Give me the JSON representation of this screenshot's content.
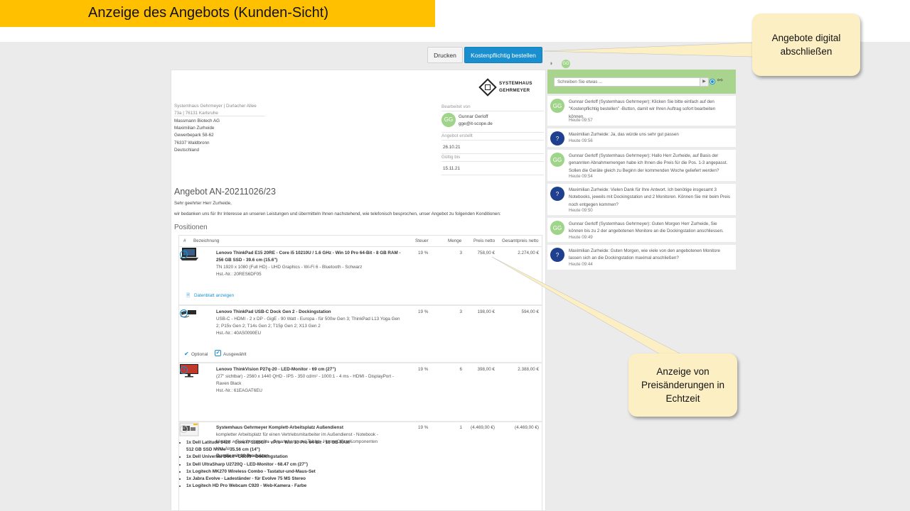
{
  "slide_title": "Anzeige des Angebots (Kunden-Sicht)",
  "toolbar": {
    "print_label": "Drucken",
    "order_label": "Kostenpflichtig bestellen"
  },
  "logo": {
    "line1": "SYSTEMHAUS",
    "line2": "GEHRMEYER"
  },
  "document": {
    "sender": "Systemhaus Gehrmeyer | Durlacher Allee",
    "sender2": "73a | 76131 Karlsruhe",
    "address": [
      "Massmann Biotech AG",
      "Maximilian Zurheide",
      "Gewerbepark 58-62",
      "76337 Waldbronn",
      "Deutschland"
    ],
    "meta": {
      "edited_label": "Bearbeitet von",
      "person_initials": "GG",
      "person_name": "Gunnar Gerloff",
      "person_email": "gge@it-scope.de",
      "created_label": "Angebot erstellt",
      "created_value": "26.10.21",
      "valid_label": "Gültig bis",
      "valid_value": "15.11.21"
    },
    "offer_title": "Angebot AN-20211026/23",
    "greeting": "Sehr geehrter Herr Zurheide,",
    "intro": "wir bedanken uns für Ihr Interesse an unseren Leistungen und übermitteln Ihnen nachstehend, wie telefonisch besprochen, unser Angebot zu folgenden Konditionen:",
    "positions_heading": "Positionen",
    "columns": {
      "num": "#",
      "name": "Bezeichnung",
      "tax": "Steuer",
      "qty": "Menge",
      "price": "Preis netto",
      "total": "Gesamtpreis netto"
    },
    "positions": [
      {
        "num": "1",
        "name": "Lenovo ThinkPad E15 20RE - Core i5 10210U / 1.6 GHz - Win 10 Pro 64-Bit - 8 GB RAM -",
        "name2": "256 GB SSD - 39.6 cm (15.6\")",
        "desc": "TN 1920 x 1080 (Full HD) - UHD Graphics - Wi-Fi 6 - Bluetooth - Schwarz",
        "desc2": "Hst.-Nr.: 20RES6DF05",
        "link": "Datenblatt anzeigen",
        "tax": "19 %",
        "qty": "3",
        "price": "758,00 €",
        "total": "2.274,00 €"
      },
      {
        "num": "2",
        "name": "Lenovo ThinkPad USB-C Dock Gen 2 - Dockingstation",
        "desc": "USB-C - HDMI - 2 x DP - GigE - 90 Watt - Europa - für 500w Gen 3; ThinkPad L13 Yoga Gen",
        "desc2": "2; P15v Gen 2; T14s Gen 2; T15p Gen 2; X13 Gen 2",
        "desc3": "Hst.-Nr.: 40AS0090EU",
        "optional": "Optional",
        "selected": "Ausgewählt",
        "tax": "19 %",
        "qty": "3",
        "price": "198,00 €",
        "total": "594,00 €"
      },
      {
        "num": "3",
        "name": "Lenovo ThinkVision P27q-20 - LED-Monitor - 69 cm (27\")",
        "desc": "(27\" sichtbar) - 2560 x 1440 QHD - IPS - 350 cd/m² - 1000:1 - 4 ms - HDMI - DisplayPort -",
        "desc2": "Raven Black",
        "desc3": "Hst.-Nr.: 61EAGAT6EU",
        "tax": "19 %",
        "qty": "6",
        "price": "398,00 €",
        "total": "2.388,00 €"
      },
      {
        "num": "4",
        "name": "Systemhaus Gehrmeyer Komplett-Arbeitsplatz Außendienst",
        "desc": "kompletter Arbeitsplatz für einen Vertriebsmitarbeiter im Außendienst - Notebook -",
        "desc2": "Monitor + Peripheriegeräte - Smartphone und Tablet - Home-Office Komponenten",
        "desc3": "Hst.-Nr.:",
        "bundle_title": "Bundle mit 10 Produkten",
        "bundle": [
          "1x Dell Latitude 5420 - Core i7 1185G7 - vPro - Win 10 Pro 64-Bit - 16 GB RAM -",
          "512 GB SSD NVMe - 35.56 cm (14\")",
          "1x Dell Universal Dock - D6000 - Dockingstation",
          "1x Dell UltraSharp U2720Q - LED-Monitor - 68.47 cm (27\")",
          "1x Logitech MK270 Wireless Combo - Tastatur-und-Maus-Set",
          "1x Jabra Evolve - Ladeständer - für Evolve 75 MS Stereo",
          "1x Logitech HD Pro Webcam C920 - Web-Kamera - Farbe"
        ],
        "tax": "19 %",
        "qty": "1",
        "price": "(4.469,00 €)",
        "total": "(4.469,00 €)"
      }
    ]
  },
  "chat": {
    "placeholder": "Schreiben Sie etwas ...",
    "messages": [
      {
        "initials": "GG",
        "text": "Gunnar Gerloff (Systemhaus Gehrmeyer): Klicken Sie bitte einfach auf den \"Kostenpflichtig bestellen\" -Button, damit wir Ihren Auftrag sofort bearbeiten können.",
        "time": "Heute 09:57"
      },
      {
        "initials": "?",
        "text": "Maximilian Zurheide: Ja, das würde uns sehr gut passen",
        "time": "Heute 09:56"
      },
      {
        "initials": "GG",
        "text": "Gunnar Gerloff (Systemhaus Gehrmeyer): Hallo Herr Zurheide, auf Basis der genannten Abnahmemengen habe ich Ihnen die Preis für die Pos. 1-3 angepasst. Sollen die Geräte gleich zu Beginn der kommenden Woche geliefert werden?",
        "time": "Heute 09:54"
      },
      {
        "initials": "?",
        "text": "Maximilian Zurheide: Vielen Dank für Ihre Antwort. Ich benötige insgesamt 3 Notebooks, jeweils mit Dockingstation und 2 Monitoren. Können Sie mir beim Preis noch entgegen kommen?",
        "time": "Heute 09:50"
      },
      {
        "initials": "GG",
        "text": "Gunnar Gerloff (Systemhaus Gehrmeyer): Guten Morgen Herr Zurheide, Sie können bis zu 2 der angebotenen Monitore an die Dockingstation anschliessen.",
        "time": "Heute 09:49"
      },
      {
        "initials": "?",
        "text": "Maximilian Zurheide: Guten Morgen, wie viele von den angebotenen Monitore lassen sich an die Dockingstation maximal anschließen?",
        "time": "Heute 09:44"
      }
    ]
  },
  "callouts": {
    "top": "Angebote digital abschließen",
    "bottom": "Anzeige von Preisänderungen in Echtzeit"
  },
  "colors": {
    "banner": "#ffc000",
    "accent": "#1a8fd0",
    "chat_header": "#a8d48e",
    "callout": "#fdefc4"
  }
}
